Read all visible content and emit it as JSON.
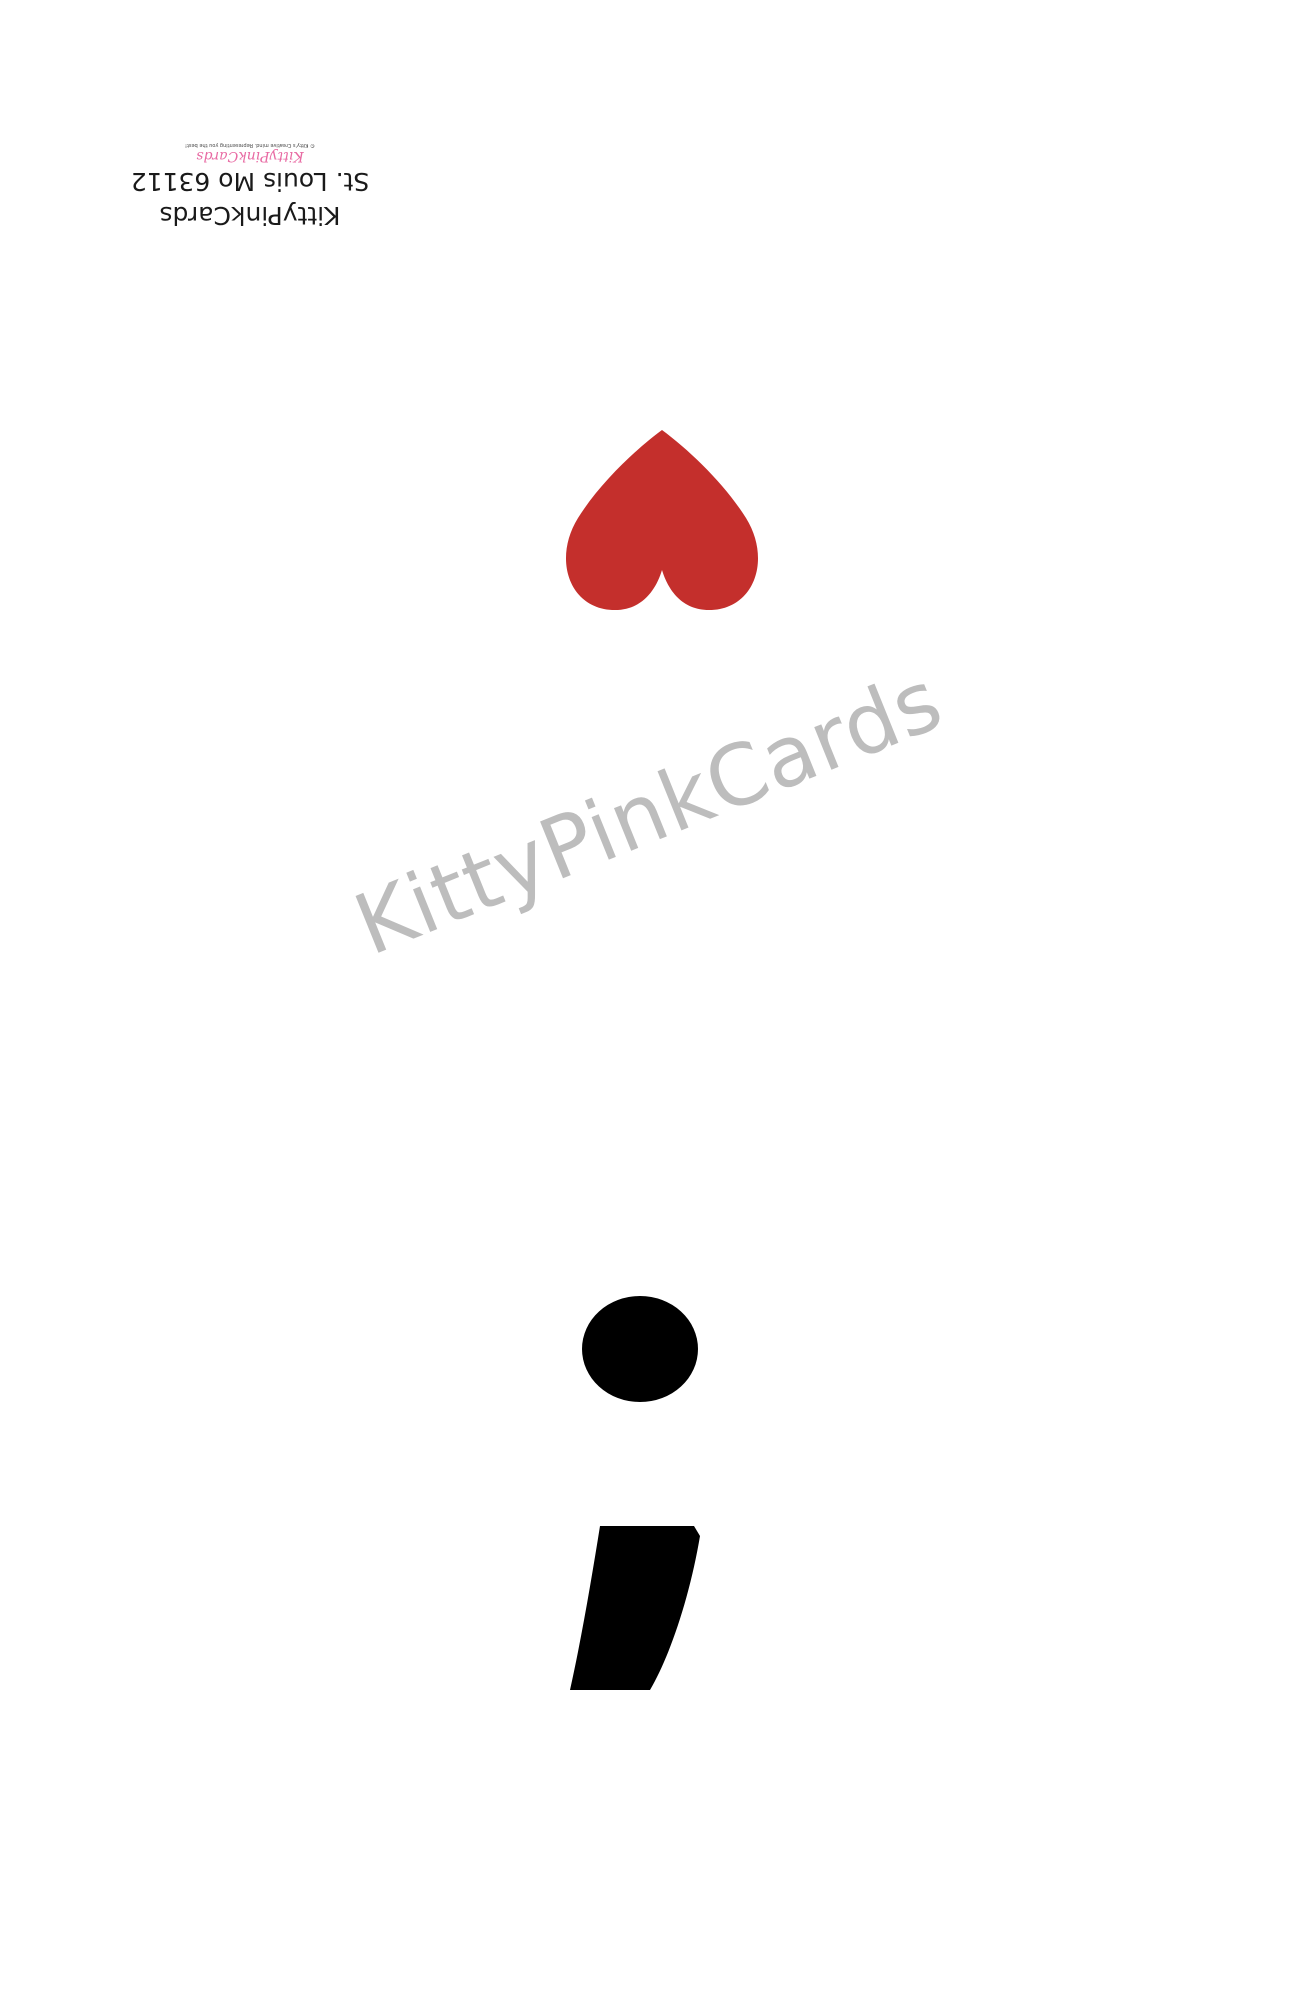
{
  "card": {
    "back": {
      "company": "KittyPinkCards",
      "address": "St. Louis Mo 63112",
      "logo_text": "KittyPinkCards",
      "tagline": "© Kitty's Creative mind. Representing you the best!"
    },
    "watermark": "KittyPinkCards",
    "symbols": {
      "heart_icon": "heart-icon",
      "semicolon_icon": "semicolon-icon"
    },
    "colors": {
      "heart": "#c42f2c",
      "semicolon": "#000000",
      "watermark": "#bdbdbd",
      "logo": "#e86aa3"
    }
  }
}
